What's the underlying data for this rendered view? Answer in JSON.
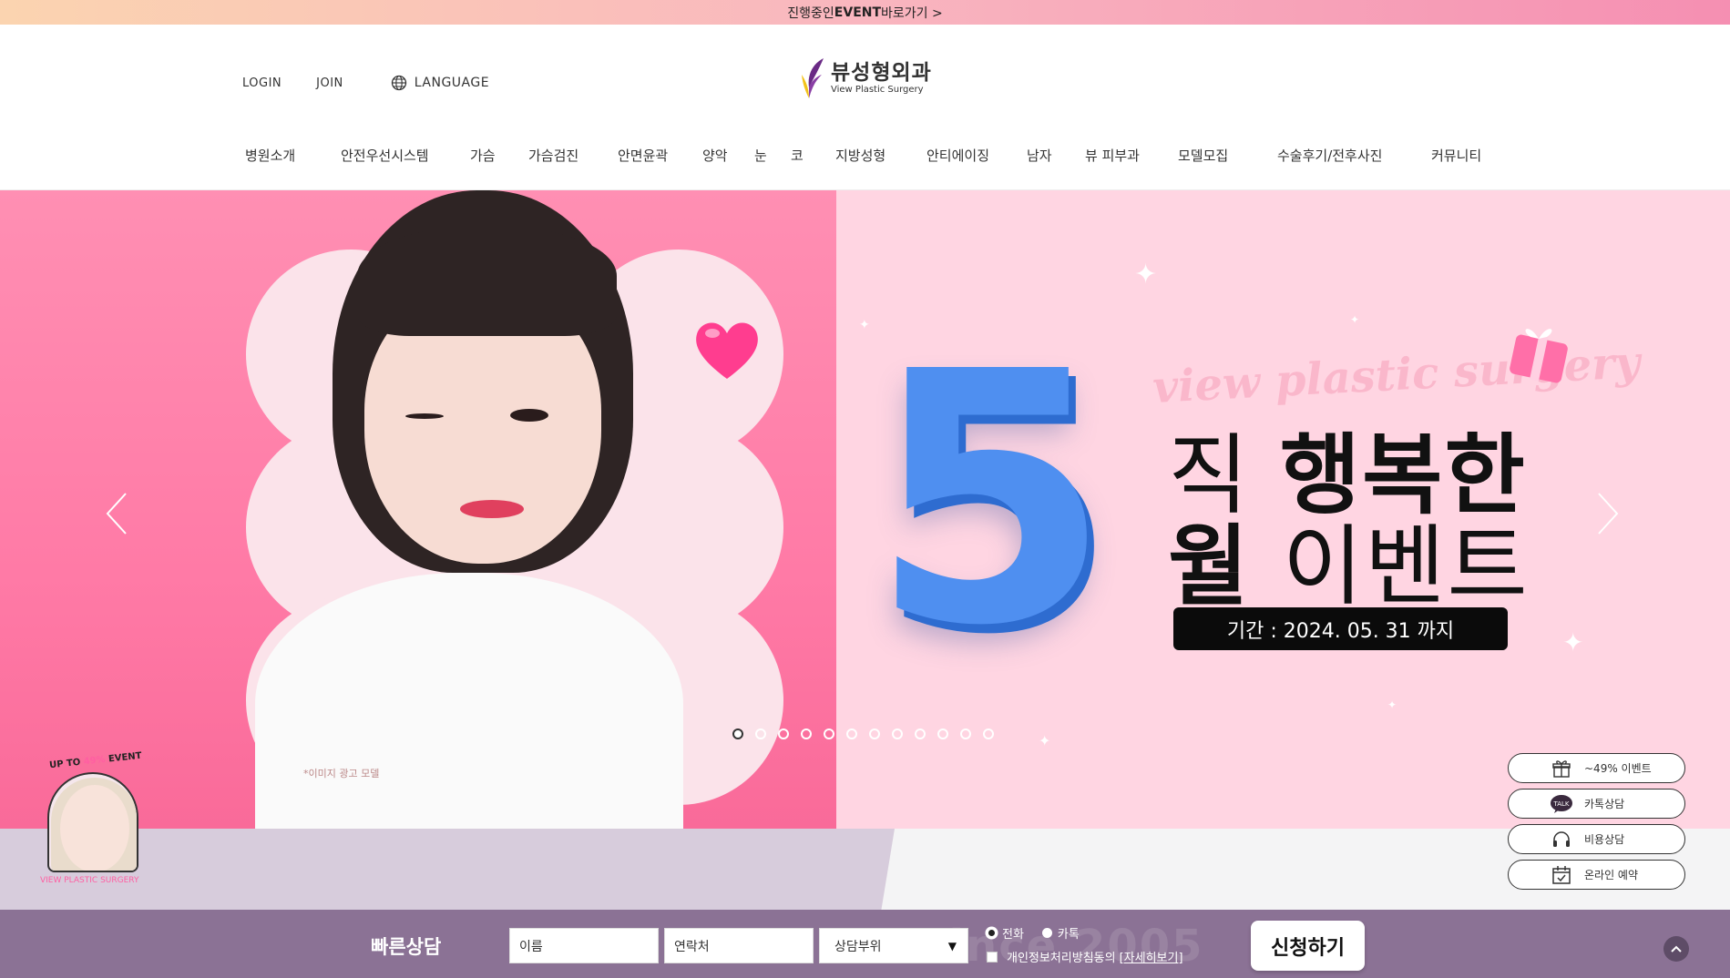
{
  "topbar": {
    "prefix": "진행중인 ",
    "event_word": "EVENT",
    "suffix": " 바로가기 >"
  },
  "header": {
    "login": "LOGIN",
    "join": "JOIN",
    "language": "LANGUAGE",
    "logo_kr": "뷰성형외과",
    "logo_en": "View Plastic Surgery"
  },
  "nav": [
    "병원소개",
    "안전우선시스템",
    "가슴",
    "가슴검진",
    "안면윤곽",
    "양악",
    "눈",
    "코",
    "지방성형",
    "안티에이징",
    "남자",
    "뷰 피부과",
    "모델모집",
    "수술후기/전후사진",
    "커뮤니티"
  ],
  "hero": {
    "ad_note": "*이미지 광고 모델",
    "watermark": "view plastic surgery",
    "big_number": "5",
    "line1_a": "직 ",
    "line1_b": "행복한",
    "line2_a": "월 ",
    "line2_b": "이벤트",
    "period": "기간 : 2024. 05. 31 까지",
    "slide_count": 12,
    "active_slide": 1,
    "bg_left": "#ff7aa6",
    "bg_right": "#ffd5e2"
  },
  "promo": {
    "arc_a": "UP TO ",
    "arc_pct": "49%",
    "arc_b": " EVENT",
    "brand": "VIEW PLASTIC SURGERY"
  },
  "quick": [
    {
      "label": "~49% 이벤트",
      "icon": "gift-icon"
    },
    {
      "label": "카톡상담",
      "icon": "kakaotalk-icon"
    },
    {
      "label": "비용상담",
      "icon": "headset-icon"
    },
    {
      "label": "온라인 예약",
      "icon": "calendar-icon"
    }
  ],
  "consult": {
    "title": "빠른상담",
    "name_placeholder": "이름",
    "phone_placeholder": "연락처",
    "area_select": "상담부위",
    "radio_phone": "전화",
    "radio_kakao": "카톡",
    "agree_text": "개인정보처리방침동의",
    "agree_link": "[자세히보기]",
    "submit": "신청하기",
    "ghost_text": "Since 2005"
  },
  "icon_talk": "TALK"
}
